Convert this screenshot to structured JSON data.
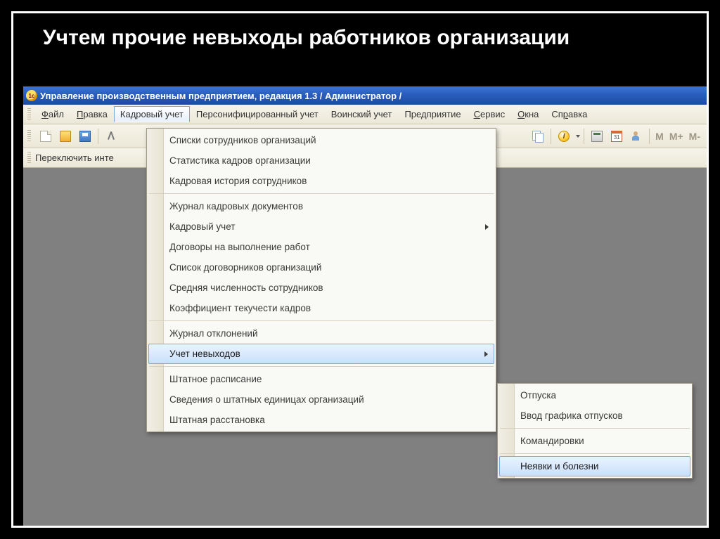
{
  "slide": {
    "title": "Учтем прочие невыходы работников организации"
  },
  "window": {
    "title": "Управление производственным предприятием, редакция 1.3 / Администратор /"
  },
  "menubar": {
    "items": [
      {
        "pre": "",
        "ul": "Ф",
        "post": "айл"
      },
      {
        "pre": "",
        "ul": "П",
        "post": "равка"
      },
      {
        "pre": "Кадровый учет",
        "ul": "",
        "post": ""
      },
      {
        "pre": "Персонифицированный учет",
        "ul": "",
        "post": ""
      },
      {
        "pre": "Воинский учет",
        "ul": "",
        "post": ""
      },
      {
        "pre": "Пре",
        "ul": "д",
        "post": "приятие"
      },
      {
        "pre": "",
        "ul": "С",
        "post": "ервис"
      },
      {
        "pre": "",
        "ul": "О",
        "post": "кна"
      },
      {
        "pre": "Сп",
        "ul": "р",
        "post": "авка"
      }
    ]
  },
  "toolbar2": {
    "label": "Переключить инте"
  },
  "mlabels": {
    "m": "M",
    "mp": "M+",
    "mm": "M-"
  },
  "dropdown": {
    "items": [
      "Списки сотрудников организаций",
      "Статистика кадров организации",
      "Кадровая история сотрудников",
      "Журнал кадровых документов",
      "Кадровый учет",
      "Договоры на выполнение работ",
      "Список договорников организаций",
      "Средняя численность сотрудников",
      "Коэффициент текучести кадров",
      "Журнал отклонений",
      "Учет невыходов",
      "Штатное расписание",
      "Сведения о штатных единицах организаций",
      "Штатная расстановка"
    ]
  },
  "submenu": {
    "items": [
      "Отпуска",
      "Ввод графика отпусков",
      "Командировки",
      "Неявки и болезни"
    ]
  }
}
